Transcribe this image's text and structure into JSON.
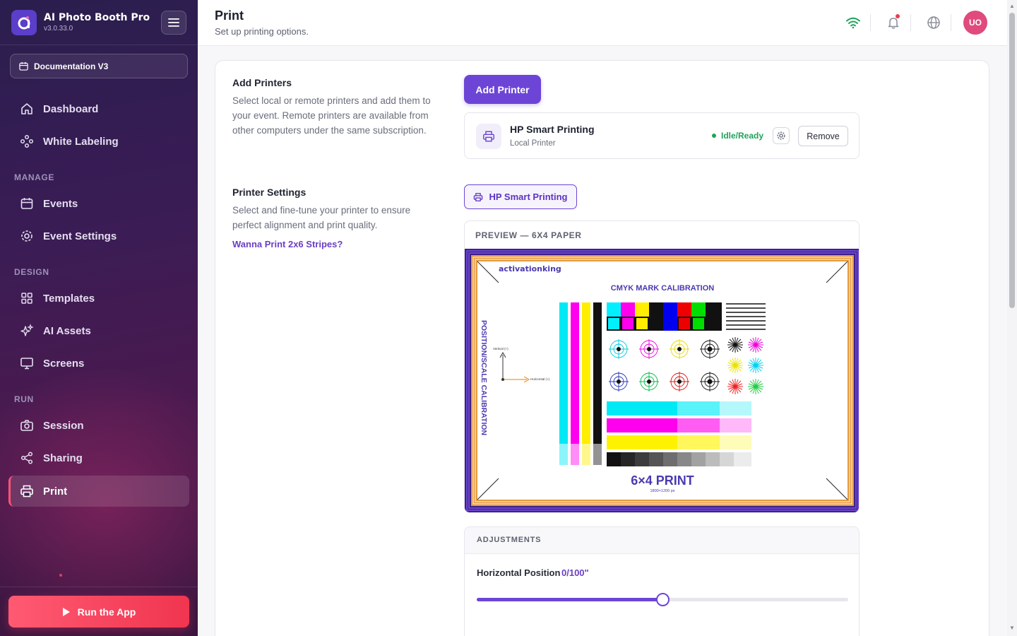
{
  "app": {
    "name": "AI Photo Booth Pro",
    "version": "v3.0.33.0"
  },
  "sidebar": {
    "event": "Documentation V3",
    "items_top": [
      {
        "label": "Dashboard",
        "icon": "home-icon"
      },
      {
        "label": "White Labeling",
        "icon": "nodes-icon"
      }
    ],
    "sections": [
      {
        "title": "MANAGE",
        "items": [
          {
            "label": "Events",
            "icon": "calendar-icon"
          },
          {
            "label": "Event Settings",
            "icon": "gear-icon"
          }
        ]
      },
      {
        "title": "DESIGN",
        "items": [
          {
            "label": "Templates",
            "icon": "grid-icon"
          },
          {
            "label": "AI Assets",
            "icon": "sparkles-icon"
          },
          {
            "label": "Screens",
            "icon": "monitor-icon"
          }
        ]
      },
      {
        "title": "RUN",
        "items": [
          {
            "label": "Session",
            "icon": "camera-icon"
          },
          {
            "label": "Sharing",
            "icon": "share-icon"
          },
          {
            "label": "Print",
            "icon": "printer-icon",
            "active": true
          }
        ]
      }
    ],
    "run_label": "Run the App"
  },
  "header": {
    "title": "Print",
    "subtitle": "Set up printing options.",
    "avatar": "UO"
  },
  "add_printers": {
    "title": "Add Printers",
    "description": "Select local or remote printers and add them to your event. Remote printers are available from other computers under the same subscription.",
    "button": "Add Printer",
    "printer": {
      "name": "HP Smart Printing",
      "type": "Local Printer",
      "status": "Idle/Ready",
      "remove": "Remove"
    }
  },
  "printer_settings": {
    "title": "Printer Settings",
    "description": "Select and fine-tune your printer to ensure perfect alignment and print quality.",
    "link": "Wanna Print 2x6 Stripes?",
    "selected": "HP Smart Printing"
  },
  "preview": {
    "heading": "PREVIEW — 6X4 PAPER",
    "brand": "activationking",
    "calibration_title": "CMYK MARK CALIBRATION",
    "side_label": "POSITION/SCALE CALIBRATION",
    "vertical_label": "Vertical (+)",
    "horizontal_label": "Horizontal (+)",
    "print_label": "6×4 PRINT",
    "print_size": "1800×1200 px"
  },
  "adjustments": {
    "heading": "ADJUSTMENTS",
    "horizontal_label": "Horizontal Position",
    "horizontal_value": "0/100\"",
    "horizontal_fraction": 0.5
  },
  "colors": {
    "accent": "#6c45d6",
    "run": "#f0354f",
    "ready": "#1fa35a"
  }
}
